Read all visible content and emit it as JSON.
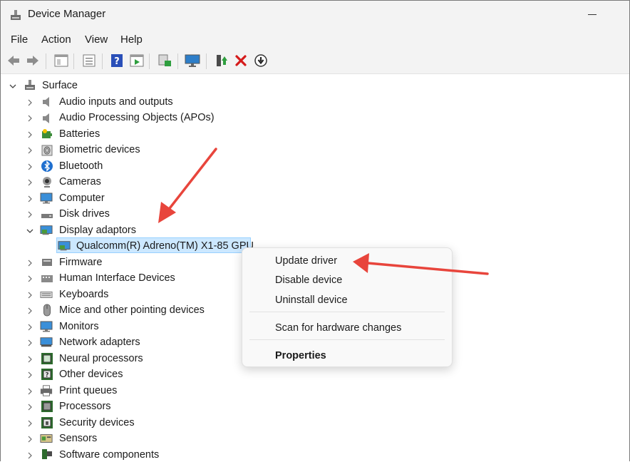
{
  "window": {
    "title": "Device Manager"
  },
  "menu": [
    "File",
    "Action",
    "View",
    "Help"
  ],
  "toolbar": {
    "icons": [
      "back-icon",
      "forward-icon",
      "properties-pane-icon",
      "list-icon",
      "help-icon",
      "run-icon",
      "scan-hardware-icon",
      "monitor-icon",
      "update-driver-icon",
      "uninstall-icon",
      "disable-icon"
    ]
  },
  "tree": {
    "root": "Surface",
    "categories": [
      "Audio inputs and outputs",
      "Audio Processing Objects (APOs)",
      "Batteries",
      "Biometric devices",
      "Bluetooth",
      "Cameras",
      "Computer",
      "Disk drives",
      "Display adaptors",
      "Firmware",
      "Human Interface Devices",
      "Keyboards",
      "Mice and other pointing devices",
      "Monitors",
      "Network adapters",
      "Neural processors",
      "Other devices",
      "Print queues",
      "Processors",
      "Security devices",
      "Sensors",
      "Software components"
    ],
    "selected_child": "Qualcomm(R) Adreno(TM) X1-85 GPU"
  },
  "context_menu": {
    "update": "Update driver",
    "disable": "Disable device",
    "uninstall": "Uninstall device",
    "scan": "Scan for hardware changes",
    "properties": "Properties"
  },
  "colors": {
    "annotation_arrow": "#e8453c",
    "selection": "#cce8ff"
  }
}
